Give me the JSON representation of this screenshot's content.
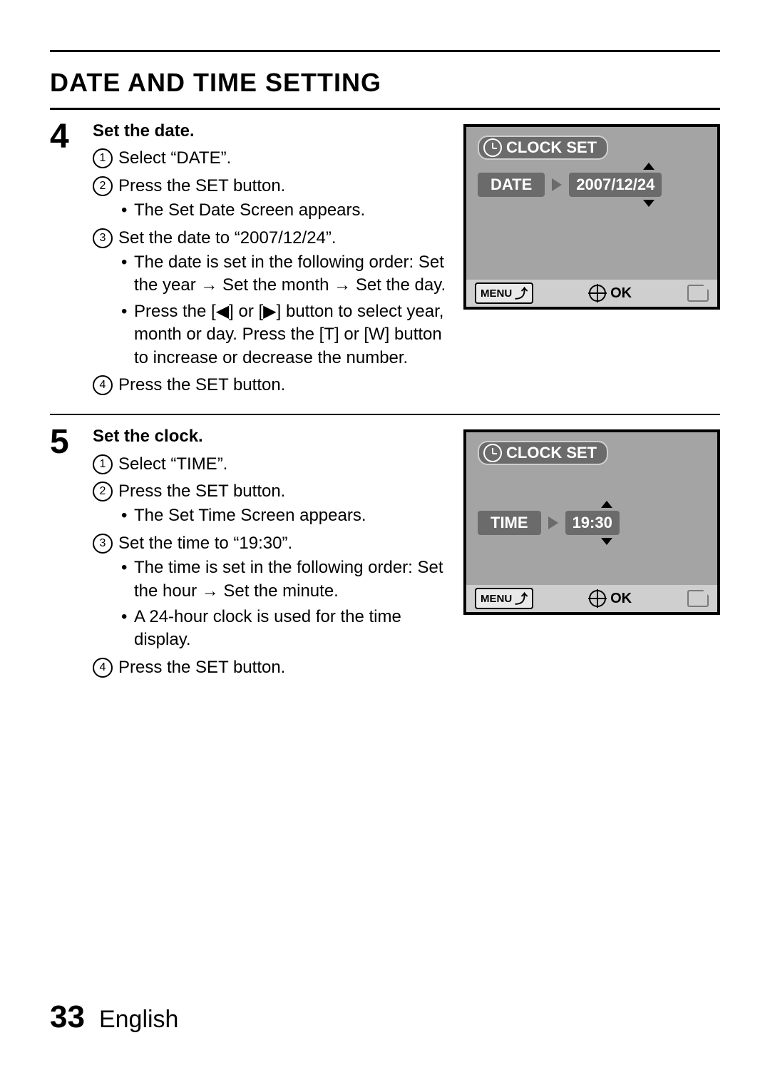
{
  "title": "DATE AND TIME SETTING",
  "steps": [
    {
      "number": "4",
      "heading": "Set the date.",
      "items": [
        {
          "n": "1",
          "text": "Select “DATE”."
        },
        {
          "n": "2",
          "text": "Press the SET button.",
          "sub": [
            "The Set Date Screen appears."
          ]
        },
        {
          "n": "3",
          "text": "Set the date to “2007/12/24”.",
          "sub": [
            "The date is set in the following order: Set the year → Set the month → Set the day.",
            "Press the [◀] or [▶] button to select year, month or day. Press the [T] or [W] button to increase or decrease the number."
          ]
        },
        {
          "n": "4",
          "text": "Press the SET button."
        }
      ],
      "screen": {
        "title": "CLOCK SET",
        "label": "DATE",
        "value": "2007/12/24",
        "rowTop": 64,
        "menu": "MENU",
        "ok": "OK"
      }
    },
    {
      "number": "5",
      "heading": "Set the clock.",
      "items": [
        {
          "n": "1",
          "text": "Select “TIME”."
        },
        {
          "n": "2",
          "text": "Press the SET button.",
          "sub": [
            "The Set Time Screen appears."
          ]
        },
        {
          "n": "3",
          "text": "Set the time to “19:30”.",
          "sub": [
            "The time is set in the following order: Set the hour → Set the minute.",
            "A 24-hour clock is used for the time display."
          ]
        },
        {
          "n": "4",
          "text": "Press the SET button."
        }
      ],
      "screen": {
        "title": "CLOCK SET",
        "label": "TIME",
        "value": "19:30",
        "rowTop": 110,
        "menu": "MENU",
        "ok": "OK"
      }
    }
  ],
  "footer": {
    "page": "33",
    "lang": "English"
  }
}
